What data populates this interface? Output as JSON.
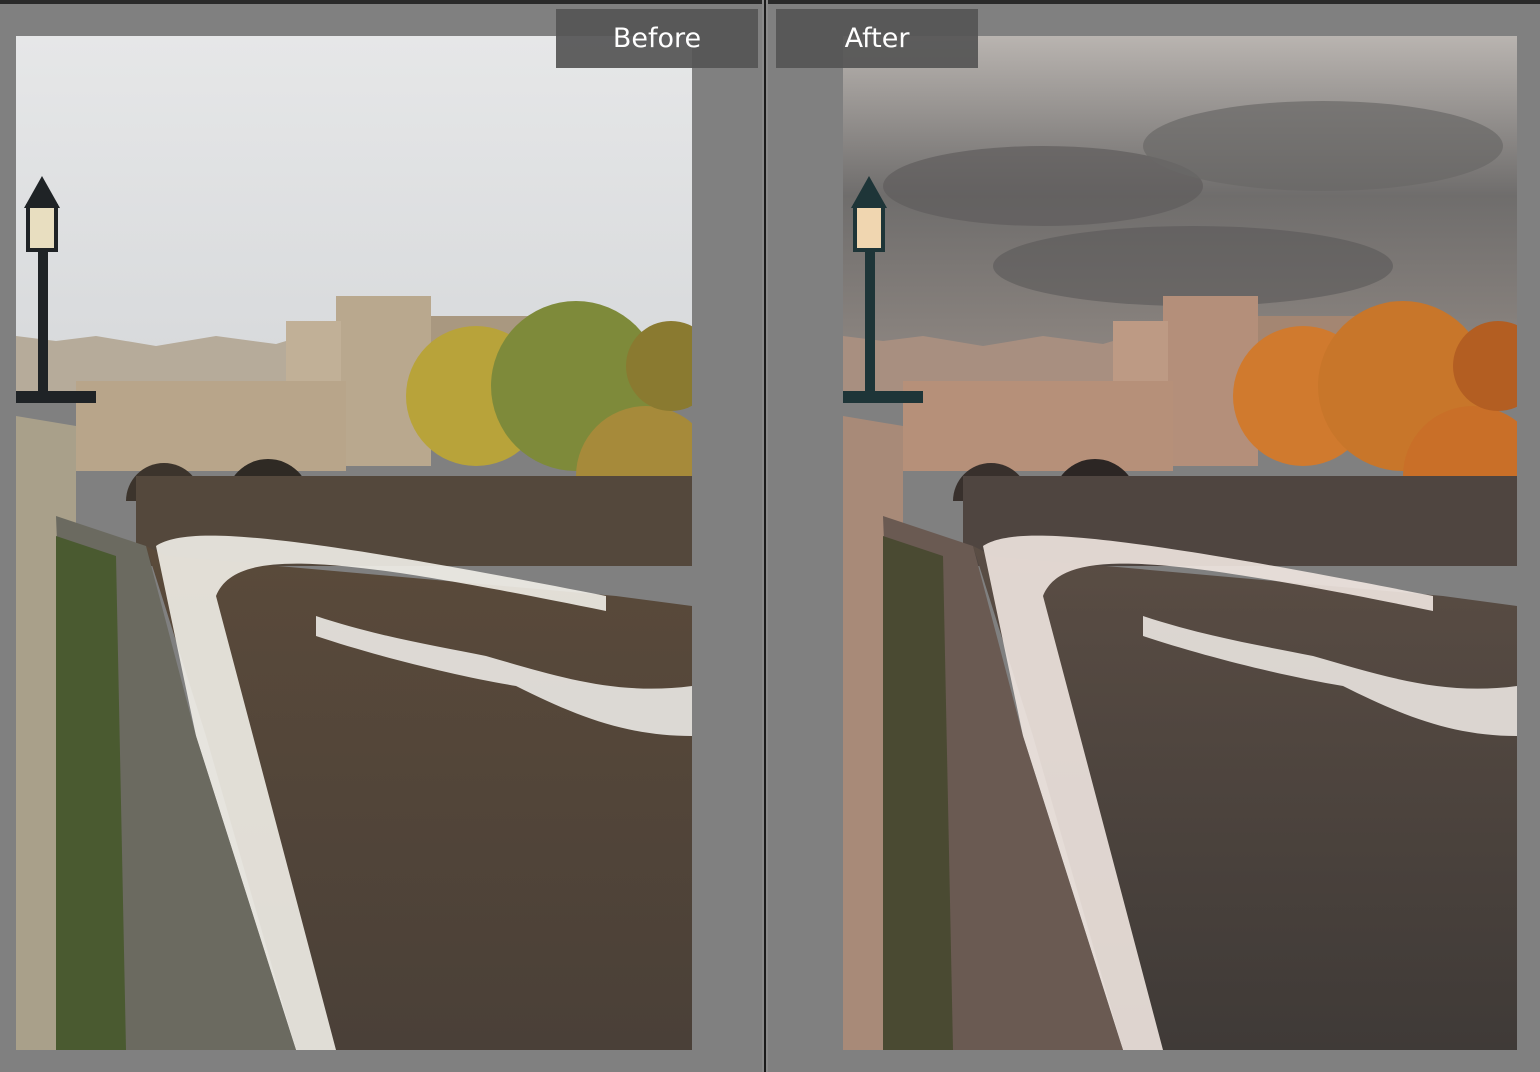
{
  "view": {
    "before_label": "Before",
    "after_label": "After"
  },
  "colors": {
    "background": "#808080",
    "label_bg": "#555555",
    "label_text": "#ffffff",
    "divider": "#1a1a1a"
  }
}
